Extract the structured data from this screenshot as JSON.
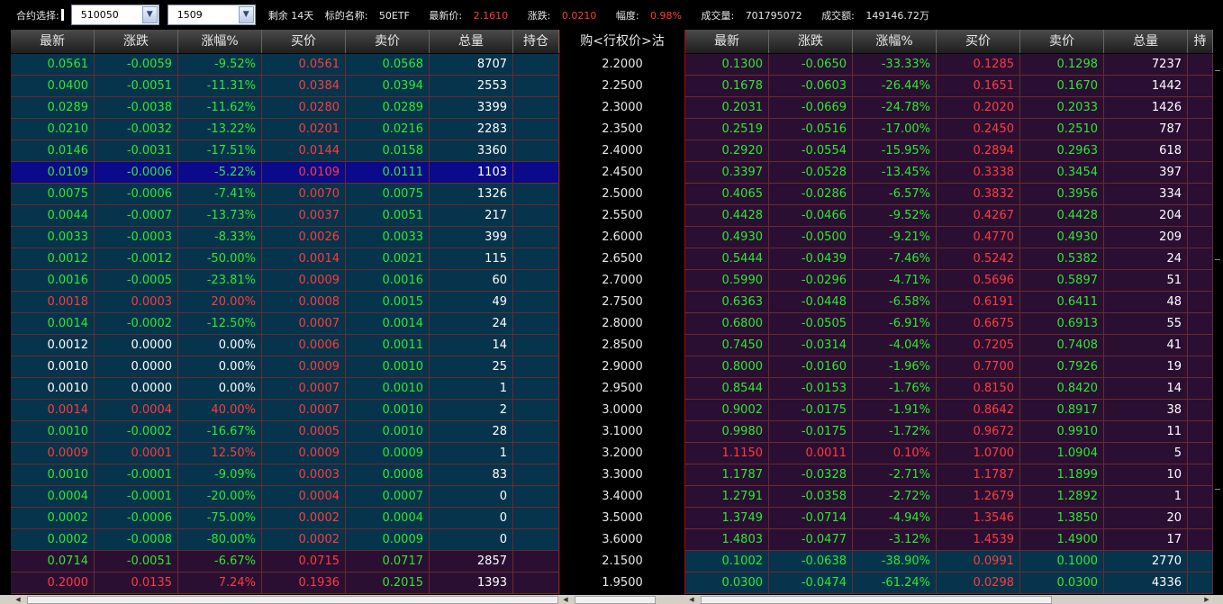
{
  "topbar": {
    "label": "合约选择:",
    "underlying_code": "510050",
    "month": "1509",
    "days_left": "剩余 14天",
    "name_label": "标的名称: ",
    "name_value": "50ETF",
    "last_label": "最新价: ",
    "last_value": "2.1610",
    "change_label": "涨跌: ",
    "change_value": "0.0210",
    "pct_label": "幅度: ",
    "pct_value": "0.98%",
    "volume_label": "成交量: ",
    "volume_value": "701795072",
    "amount_label": "成交额: ",
    "amount_value": "149146.72万"
  },
  "headers": {
    "call": [
      "最新",
      "涨跌",
      "涨幅%",
      "买价",
      "卖价",
      "总量",
      "持仓"
    ],
    "strike": "购<行权价>沽",
    "put": [
      "最新",
      "涨跌",
      "涨幅%",
      "买价",
      "卖价",
      "总量",
      "持"
    ]
  },
  "calls": [
    [
      "0.0561",
      "-0.0059",
      "-9.52%",
      "0.0561",
      "0.0568",
      "8707"
    ],
    [
      "0.0400",
      "-0.0051",
      "-11.31%",
      "0.0384",
      "0.0394",
      "2553"
    ],
    [
      "0.0289",
      "-0.0038",
      "-11.62%",
      "0.0280",
      "0.0289",
      "3399"
    ],
    [
      "0.0210",
      "-0.0032",
      "-13.22%",
      "0.0201",
      "0.0216",
      "2283"
    ],
    [
      "0.0146",
      "-0.0031",
      "-17.51%",
      "0.0144",
      "0.0158",
      "3360"
    ],
    [
      "0.0109",
      "-0.0006",
      "-5.22%",
      "0.0109",
      "0.0111",
      "1103"
    ],
    [
      "0.0075",
      "-0.0006",
      "-7.41%",
      "0.0070",
      "0.0075",
      "1326"
    ],
    [
      "0.0044",
      "-0.0007",
      "-13.73%",
      "0.0037",
      "0.0051",
      "217"
    ],
    [
      "0.0033",
      "-0.0003",
      "-8.33%",
      "0.0026",
      "0.0033",
      "399"
    ],
    [
      "0.0012",
      "-0.0012",
      "-50.00%",
      "0.0014",
      "0.0021",
      "115"
    ],
    [
      "0.0016",
      "-0.0005",
      "-23.81%",
      "0.0009",
      "0.0016",
      "60"
    ],
    [
      "0.0018",
      "0.0003",
      "20.00%",
      "0.0008",
      "0.0015",
      "49"
    ],
    [
      "0.0014",
      "-0.0002",
      "-12.50%",
      "0.0007",
      "0.0014",
      "24"
    ],
    [
      "0.0012",
      "0.0000",
      "0.00%",
      "0.0006",
      "0.0011",
      "14"
    ],
    [
      "0.0010",
      "0.0000",
      "0.00%",
      "0.0009",
      "0.0010",
      "25"
    ],
    [
      "0.0010",
      "0.0000",
      "0.00%",
      "0.0007",
      "0.0010",
      "1"
    ],
    [
      "0.0014",
      "0.0004",
      "40.00%",
      "0.0007",
      "0.0010",
      "2"
    ],
    [
      "0.0010",
      "-0.0002",
      "-16.67%",
      "0.0005",
      "0.0010",
      "28"
    ],
    [
      "0.0009",
      "0.0001",
      "12.50%",
      "0.0009",
      "0.0009",
      "1"
    ],
    [
      "0.0010",
      "-0.0001",
      "-9.09%",
      "0.0003",
      "0.0008",
      "83"
    ],
    [
      "0.0004",
      "-0.0001",
      "-20.00%",
      "0.0004",
      "0.0007",
      "0"
    ],
    [
      "0.0002",
      "-0.0006",
      "-75.00%",
      "0.0002",
      "0.0004",
      "0"
    ],
    [
      "0.0002",
      "-0.0008",
      "-80.00%",
      "0.0002",
      "0.0009",
      "0"
    ],
    [
      "0.0714",
      "-0.0051",
      "-6.67%",
      "0.0715",
      "0.0717",
      "2857"
    ],
    [
      "0.2000",
      "0.0135",
      "7.24%",
      "0.1936",
      "0.2015",
      "1393"
    ]
  ],
  "strikes": [
    "2.2000",
    "2.2500",
    "2.3000",
    "2.3500",
    "2.4000",
    "2.4500",
    "2.5000",
    "2.5500",
    "2.6000",
    "2.6500",
    "2.7000",
    "2.7500",
    "2.8000",
    "2.8500",
    "2.9000",
    "2.9500",
    "3.0000",
    "3.1000",
    "3.2000",
    "3.3000",
    "3.4000",
    "3.5000",
    "3.6000",
    "2.1500",
    "1.9500"
  ],
  "puts": [
    [
      "0.1300",
      "-0.0650",
      "-33.33%",
      "0.1285",
      "0.1298",
      "7237"
    ],
    [
      "0.1678",
      "-0.0603",
      "-26.44%",
      "0.1651",
      "0.1670",
      "1442"
    ],
    [
      "0.2031",
      "-0.0669",
      "-24.78%",
      "0.2020",
      "0.2033",
      "1426"
    ],
    [
      "0.2519",
      "-0.0516",
      "-17.00%",
      "0.2450",
      "0.2510",
      "787"
    ],
    [
      "0.2920",
      "-0.0554",
      "-15.95%",
      "0.2894",
      "0.2963",
      "618"
    ],
    [
      "0.3397",
      "-0.0528",
      "-13.45%",
      "0.3338",
      "0.3454",
      "397"
    ],
    [
      "0.4065",
      "-0.0286",
      "-6.57%",
      "0.3832",
      "0.3956",
      "334"
    ],
    [
      "0.4428",
      "-0.0466",
      "-9.52%",
      "0.4267",
      "0.4428",
      "204"
    ],
    [
      "0.4930",
      "-0.0500",
      "-9.21%",
      "0.4770",
      "0.4930",
      "209"
    ],
    [
      "0.5444",
      "-0.0439",
      "-7.46%",
      "0.5242",
      "0.5382",
      "24"
    ],
    [
      "0.5990",
      "-0.0296",
      "-4.71%",
      "0.5696",
      "0.5897",
      "51"
    ],
    [
      "0.6363",
      "-0.0448",
      "-6.58%",
      "0.6191",
      "0.6411",
      "48"
    ],
    [
      "0.6800",
      "-0.0505",
      "-6.91%",
      "0.6675",
      "0.6913",
      "55"
    ],
    [
      "0.7450",
      "-0.0314",
      "-4.04%",
      "0.7205",
      "0.7408",
      "41"
    ],
    [
      "0.8000",
      "-0.0160",
      "-1.96%",
      "0.7700",
      "0.7926",
      "19"
    ],
    [
      "0.8544",
      "-0.0153",
      "-1.76%",
      "0.8150",
      "0.8420",
      "14"
    ],
    [
      "0.9002",
      "-0.0175",
      "-1.91%",
      "0.8642",
      "0.8917",
      "38"
    ],
    [
      "0.9980",
      "-0.0175",
      "-1.72%",
      "0.9672",
      "0.9910",
      "11"
    ],
    [
      "1.1150",
      "0.0011",
      "0.10%",
      "1.0700",
      "1.0904",
      "5"
    ],
    [
      "1.1787",
      "-0.0328",
      "-2.71%",
      "1.1787",
      "1.1899",
      "10"
    ],
    [
      "1.2791",
      "-0.0358",
      "-2.72%",
      "1.2679",
      "1.2892",
      "1"
    ],
    [
      "1.3749",
      "-0.0714",
      "-4.94%",
      "1.3546",
      "1.3850",
      "20"
    ],
    [
      "1.4803",
      "-0.0477",
      "-3.12%",
      "1.4539",
      "1.4900",
      "17"
    ],
    [
      "0.1002",
      "-0.0638",
      "-38.90%",
      "0.0991",
      "0.1000",
      "2770"
    ],
    [
      "0.0300",
      "-0.0474",
      "-61.24%",
      "0.0298",
      "0.0300",
      "4336"
    ]
  ],
  "call_row_bg": [
    "blue",
    "blue",
    "blue",
    "blue",
    "blue",
    "sel",
    "blue",
    "blue",
    "blue",
    "blue",
    "blue",
    "blue",
    "blue",
    "blue",
    "blue",
    "blue",
    "blue",
    "blue",
    "blue",
    "blue",
    "blue",
    "blue",
    "blue",
    "purple",
    "purple"
  ],
  "put_row_bg": [
    "purple",
    "purple",
    "purple",
    "purple",
    "purple",
    "purple",
    "purple",
    "purple",
    "purple",
    "purple",
    "purple",
    "purple",
    "purple",
    "purple",
    "purple",
    "purple",
    "purple",
    "purple",
    "purple",
    "purple",
    "purple",
    "purple",
    "purple",
    "blue",
    "blue"
  ],
  "colors": {
    "up": "#ff3b3b",
    "down": "#2ee82e",
    "flat": "#ffffff",
    "call_bg": "#06344c",
    "put_bg": "#2a0f33",
    "selected_bg": "#0a0a8a"
  }
}
